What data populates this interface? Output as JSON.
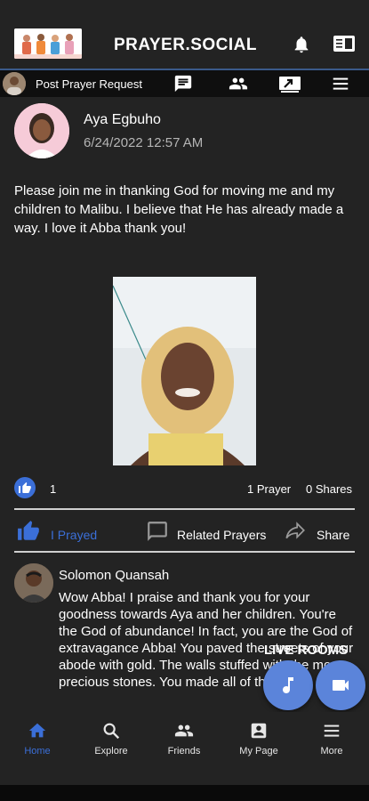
{
  "header": {
    "brand": "PRAYER.SOCIAL",
    "icons": [
      "bell-icon",
      "reader-icon"
    ]
  },
  "actionbar": {
    "post_label": "Post Prayer Request",
    "icons": [
      "message-icon",
      "people-icon",
      "upload-icon",
      "menu-icon"
    ]
  },
  "post": {
    "author": "Aya Egbuho",
    "date": "6/24/2022 12:57 AM",
    "text": "Please join me in thanking God for moving me and my children to Malibu. I believe that He has already made a way. I love it Abba thank you!",
    "like_count": "1",
    "prayer_count": "1 Prayer",
    "share_count": "0 Shares"
  },
  "actions": {
    "prayed": "I Prayed",
    "related": "Related Prayers",
    "share": "Share"
  },
  "comment": {
    "author": "Solomon Quansah",
    "text": "Wow Abba! I praise and thank you for your goodness towards Aya and her children. You're the God of abundance! In fact, you are the God of extravagance Abba! You paved the streets of your abode with gold. The walls stuffed with the most precious stones. You made all of them."
  },
  "live": {
    "label": "LIVE ROOMS"
  },
  "nav": {
    "items": [
      {
        "label": "Home",
        "icon": "home-icon"
      },
      {
        "label": "Explore",
        "icon": "search-icon"
      },
      {
        "label": "Friends",
        "icon": "people-icon"
      },
      {
        "label": "My Page",
        "icon": "account-box-icon"
      },
      {
        "label": "More",
        "icon": "menu-icon"
      }
    ],
    "active": "Home"
  },
  "colors": {
    "accent": "#3b6fd8",
    "fab": "#5b84da",
    "background": "#232323"
  }
}
